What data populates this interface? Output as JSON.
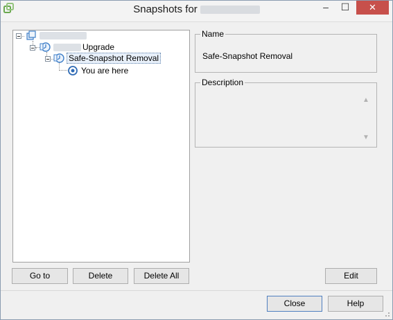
{
  "window": {
    "title": "Snapshots for",
    "minimize_glyph": "–",
    "maximize_glyph": "☐",
    "close_glyph": "✕"
  },
  "tree": {
    "nodes": [
      {
        "label": "",
        "icon": "vm-icon",
        "redacted": true
      },
      {
        "label": "Upgrade",
        "icon": "snapshot-icon",
        "redacted_prefix": true
      },
      {
        "label": "Safe-Snapshot Removal",
        "icon": "snapshot-icon",
        "selected": true
      },
      {
        "label": "You are here",
        "icon": "you-are-here-icon"
      }
    ]
  },
  "details": {
    "name_legend": "Name",
    "name_value": "Safe-Snapshot Removal",
    "description_legend": "Description",
    "description_value": ""
  },
  "buttons": {
    "goto": "Go to",
    "delete": "Delete",
    "delete_all": "Delete All",
    "edit": "Edit",
    "close": "Close",
    "help": "Help"
  },
  "colors": {
    "accent": "#4f7fbf",
    "close_button": "#c7504b",
    "snapshot_icon": "#3f7fc8"
  }
}
